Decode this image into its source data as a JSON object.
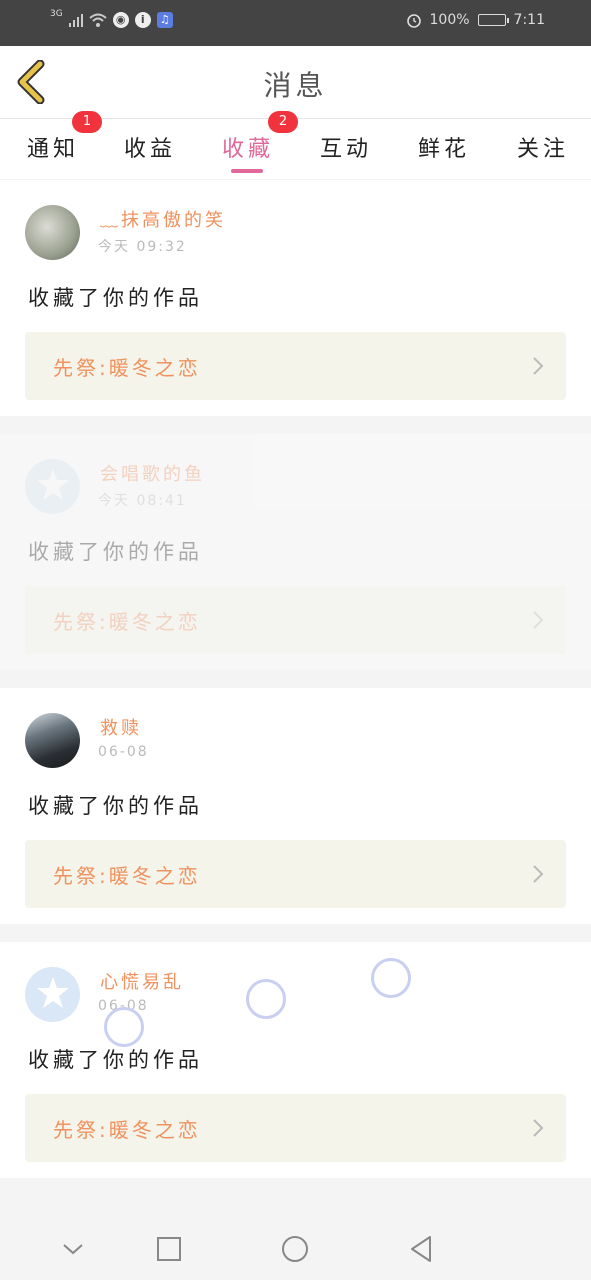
{
  "status_bar": {
    "network": "3G",
    "battery": "100%",
    "time": "7:11",
    "icons": [
      "signal-icon",
      "wifi-icon",
      "globe-icon",
      "info-icon",
      "music-icon",
      "alarm-icon",
      "battery-icon"
    ]
  },
  "header": {
    "title": "消息",
    "back_icon": "chevron-left-icon"
  },
  "tabs": [
    {
      "label": "通知",
      "badge": "1"
    },
    {
      "label": "收益",
      "badge": ""
    },
    {
      "label": "收藏",
      "badge": "2",
      "active": true
    },
    {
      "label": "互动",
      "badge": ""
    },
    {
      "label": "鲜花",
      "badge": ""
    },
    {
      "label": "关注",
      "badge": ""
    }
  ],
  "messages": [
    {
      "user": "﹏抹高傲的笑",
      "time": "今天  09:32",
      "text": "收藏了你的作品",
      "work": "先祭:暖冬之恋"
    },
    {
      "user": "会唱歌的鱼",
      "time": "今天  08:41",
      "text": "收藏了你的作品",
      "work": "先祭:暖冬之恋"
    },
    {
      "user": "救赎",
      "time": "06-08",
      "text": "收藏了你的作品",
      "work": "先祭:暖冬之恋"
    },
    {
      "user": "心慌易乱",
      "time": "06-08",
      "text": "收藏了你的作品",
      "work": "先祭:暖冬之恋"
    }
  ],
  "nav_bar": {
    "icons": [
      "chevron-down-icon",
      "square-icon",
      "circle-icon",
      "triangle-back-icon"
    ]
  },
  "colors": {
    "accent": "#e0689a",
    "name": "#f0925f",
    "badge": "#f0333d",
    "back_arrow": "#e8c34a"
  }
}
